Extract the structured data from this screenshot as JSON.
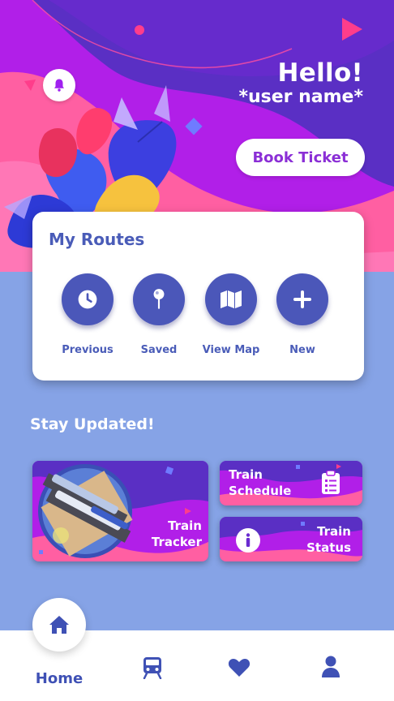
{
  "header": {
    "greeting": "Hello!",
    "user_name": "*user name*",
    "book_button": "Book Ticket"
  },
  "routes": {
    "title": "My Routes",
    "items": [
      {
        "label": "Previous",
        "icon": "clock-icon"
      },
      {
        "label": "Saved",
        "icon": "pin-icon"
      },
      {
        "label": "View Map",
        "icon": "map-icon"
      },
      {
        "label": "New",
        "icon": "plus-icon"
      }
    ]
  },
  "updates": {
    "title": "Stay Updated!",
    "cards": {
      "tracker": {
        "line1": "Train",
        "line2": "Tracker"
      },
      "schedule": {
        "line1": "Train",
        "line2": "Schedule"
      },
      "status": {
        "line1": "Train",
        "line2": "Status"
      }
    }
  },
  "nav": {
    "home_label": "Home",
    "items": [
      "home-icon",
      "train-icon",
      "heart-icon",
      "user-icon"
    ]
  },
  "colors": {
    "accent": "#4b57b9",
    "purple": "#a020f0",
    "pink": "#ff5fa2",
    "background": "#86a3e6"
  }
}
